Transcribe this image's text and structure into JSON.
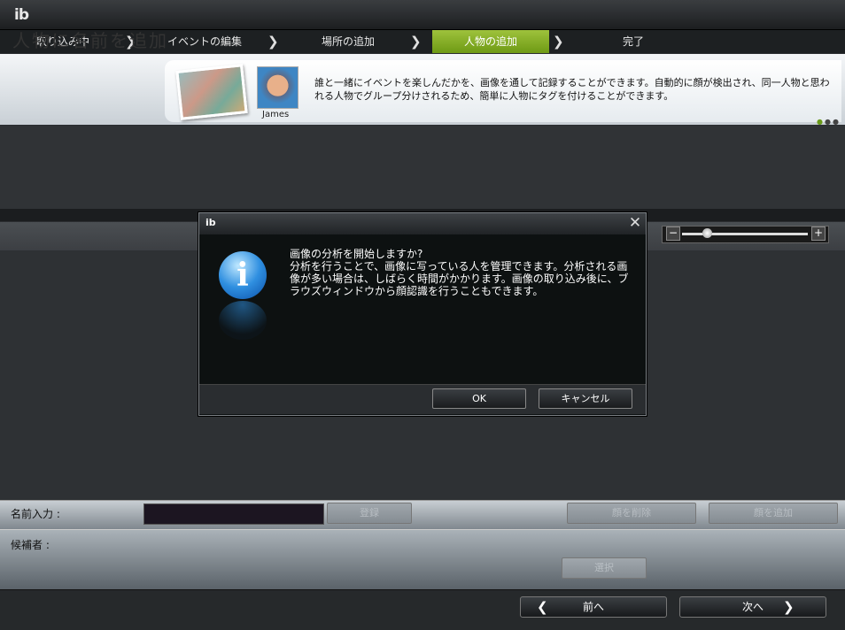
{
  "app": {
    "logo": "ib"
  },
  "steps": [
    {
      "label": "取り込み中"
    },
    {
      "label": "イベントの編集"
    },
    {
      "label": "場所の追加"
    },
    {
      "label": "人物の追加"
    },
    {
      "label": "完了"
    }
  ],
  "steps_active": "人物の追加",
  "banner": {
    "title": "人物に名前を追加",
    "sample_name": "James",
    "description": "誰と一緒にイベントを楽しんだかを、画像を通して記録することができます。自動的に顔が検出され、同一人物と思われる人物でグループ分けされるため、簡単に人物にタグを付けることができます。"
  },
  "zoom": {
    "minus": "−",
    "plus": "+",
    "level": 0.2
  },
  "name_bar": {
    "label": "名前入力 :",
    "input_value": "",
    "register_label": "登録",
    "btn2_label": "顔を削除",
    "btn3_label": "顔を追加"
  },
  "candidates": {
    "label": "候補者 :",
    "select_label": "選択"
  },
  "footer": {
    "prev_label": "前へ",
    "next_label": "次へ"
  },
  "dialog": {
    "title": "ib",
    "close": "✕",
    "message_line1": "画像の分析を開始しますか?",
    "message_body": "分析を行うことで、画像に写っている人を管理できます。分析される画像が多い場合は、しばらく時間がかかります。画像の取り込み後に、ブラウズウィンドウから顔認識を行うこともできます。",
    "ok_label": "OK",
    "cancel_label": "キャンセル",
    "icon": "info-icon"
  }
}
